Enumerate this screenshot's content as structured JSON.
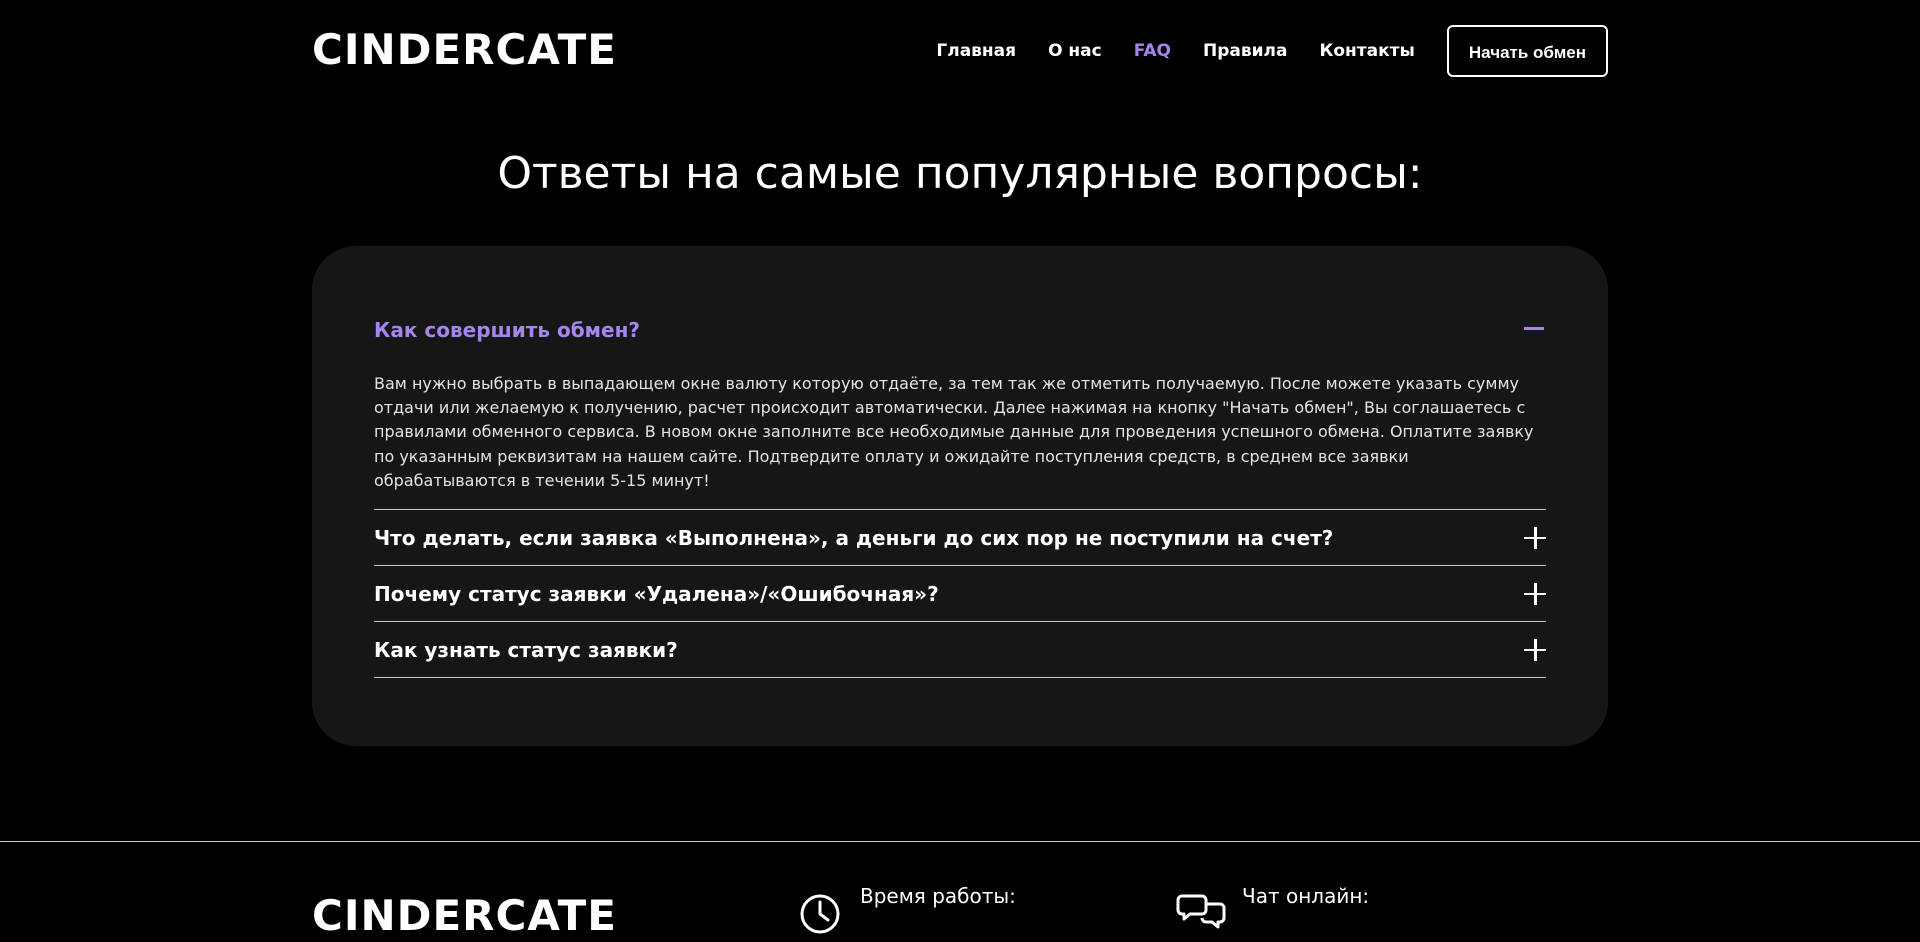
{
  "brand": {
    "logo": "CINDERCATE"
  },
  "nav": {
    "items": [
      {
        "label": "Главная"
      },
      {
        "label": "О нас"
      },
      {
        "label": "FAQ"
      },
      {
        "label": "Правила"
      },
      {
        "label": "Контакты"
      }
    ],
    "active": "FAQ",
    "cta_label": "Начать обмен"
  },
  "colors": {
    "accent": "#a685f0",
    "background": "#000000",
    "card": "#161616"
  },
  "main": {
    "title": "Ответы на самые популярные вопросы:",
    "faq": [
      {
        "question": "Как совершить обмен?",
        "expanded": true,
        "answer": "Вам нужно выбрать в выпадающем окне валюту которую отдаёте, за тем так же отметить получаемую. После можете указать сумму отдачи или желаемую к получению, расчет происходит автоматически. Далее нажимая на кнопку \"Начать обмен\", Вы соглашаетесь с правилами обменного сервиса. В новом окне заполните все необходимые данные для проведения успешного обмена. Оплатите заявку по указанным реквизитам на нашем сайте. Подтвердите оплату и ожидайте поступления средств, в среднем все заявки обрабатываются в течении 5-15 минут!"
      },
      {
        "question": "Что делать, если заявка «Выполнена», а деньги до сих пор не поступили на счет?",
        "expanded": false
      },
      {
        "question": "Почему статус заявки «Удалена»/«Ошибочная»?",
        "expanded": false
      },
      {
        "question": "Как узнать статус заявки?",
        "expanded": false
      }
    ]
  },
  "footer": {
    "logo": "CINDERCATE",
    "work_hours": {
      "title": "Время работы:",
      "icon": "clock-icon"
    },
    "chat": {
      "title": "Чат онлайн:",
      "icon": "chat-bubbles-icon"
    }
  }
}
